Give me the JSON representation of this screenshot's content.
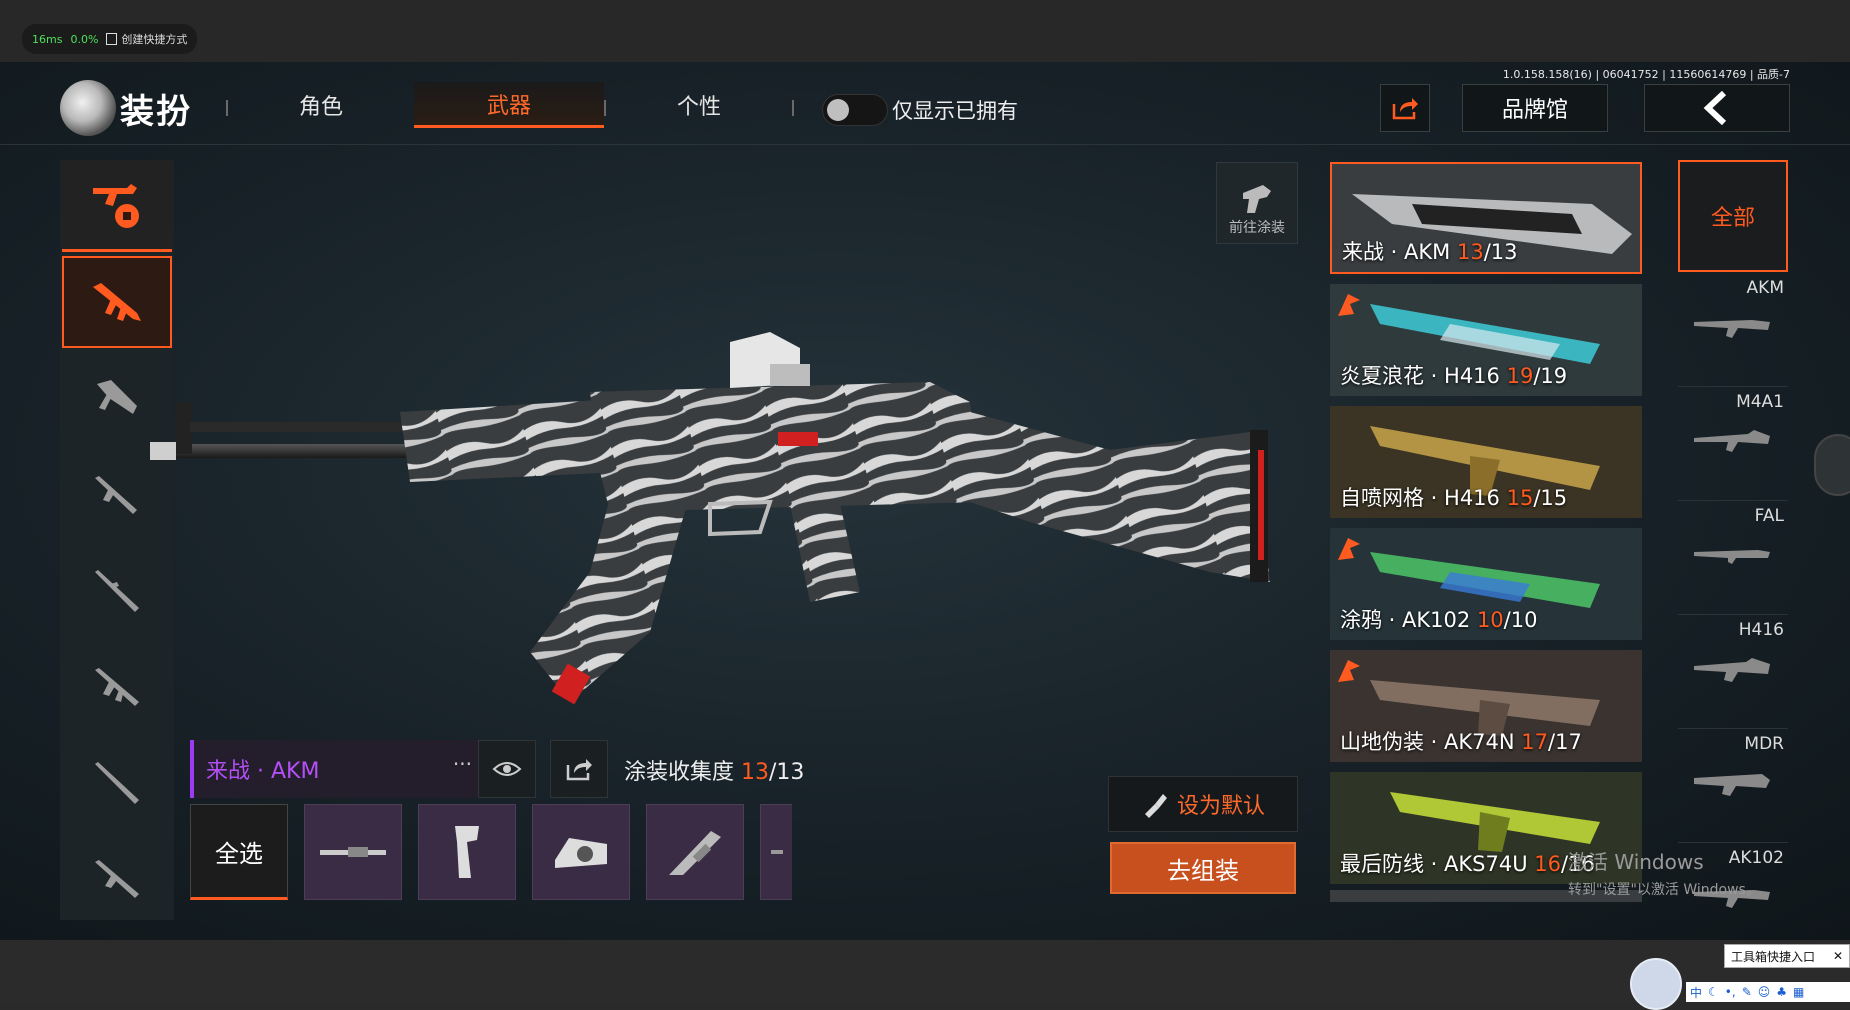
{
  "perf": {
    "latency": "16ms",
    "cpu": "0.0%",
    "shortcut": "创建快捷方式"
  },
  "version": "1.0.158.158(16) | 06041752 | 11560614769 | 品质-7",
  "header": {
    "title": "装扮",
    "tabs": [
      {
        "label": "角色",
        "active": false
      },
      {
        "label": "武器",
        "active": true
      },
      {
        "label": "个性",
        "active": false
      }
    ],
    "toggle_label": "仅显示已拥有",
    "toggle_on": false,
    "brand_label": "品牌馆"
  },
  "left_categories": [
    "all-weapons-icon",
    "assault-rifle-icon",
    "smg-icon",
    "shotgun-icon",
    "sniper-icon",
    "dmr-icon",
    "marksman-icon",
    "lmg-icon"
  ],
  "goto_paint_label": "前往涂装",
  "selected_skin": {
    "name": "来战 · AKM"
  },
  "collection": {
    "label": "涂装收集度",
    "current": "13",
    "total": "/13"
  },
  "select_all": "全选",
  "set_default": "设为默认",
  "assemble": "去组装",
  "skins": [
    {
      "name": "来战 · AKM",
      "cur": "13",
      "total": "/13",
      "bg": "#3a3d40",
      "accent": "#d9d9d9",
      "flag": false,
      "selected": true
    },
    {
      "name": "炎夏浪花 · H416",
      "cur": "19",
      "total": "/19",
      "bg": "#2f3a3c",
      "accent": "#3fd4e0",
      "flag": true,
      "selected": false
    },
    {
      "name": "自喷网格 · H416",
      "cur": "15",
      "total": "/15",
      "bg": "#3b3424",
      "accent": "#c9a54a",
      "flag": false,
      "selected": false
    },
    {
      "name": "涂鸦 · AK102",
      "cur": "10",
      "total": "/10",
      "bg": "#26343a",
      "accent": "#4fd06a",
      "flag": true,
      "selected": false
    },
    {
      "name": "山地伪装 · AK74N",
      "cur": "17",
      "total": "/17",
      "bg": "#3a3330",
      "accent": "#8a7466",
      "flag": true,
      "selected": false
    },
    {
      "name": "最后防线 · AKS74U",
      "cur": "16",
      "total": "/16",
      "bg": "#2f3526",
      "accent": "#c7e03a",
      "flag": false,
      "selected": false
    }
  ],
  "right_filter": {
    "all_label": "全部",
    "weapons": [
      "AKM",
      "M4A1",
      "FAL",
      "H416",
      "MDR",
      "AK102"
    ]
  },
  "os": {
    "activate_line1": "激活 Windows",
    "activate_line2": "转到\"设置\"以激活 Windows。",
    "toolbox": "工具箱快捷入口",
    "ime": "中"
  },
  "colors": {
    "accent": "#ff5a1f",
    "rare": "#b44ff5"
  }
}
